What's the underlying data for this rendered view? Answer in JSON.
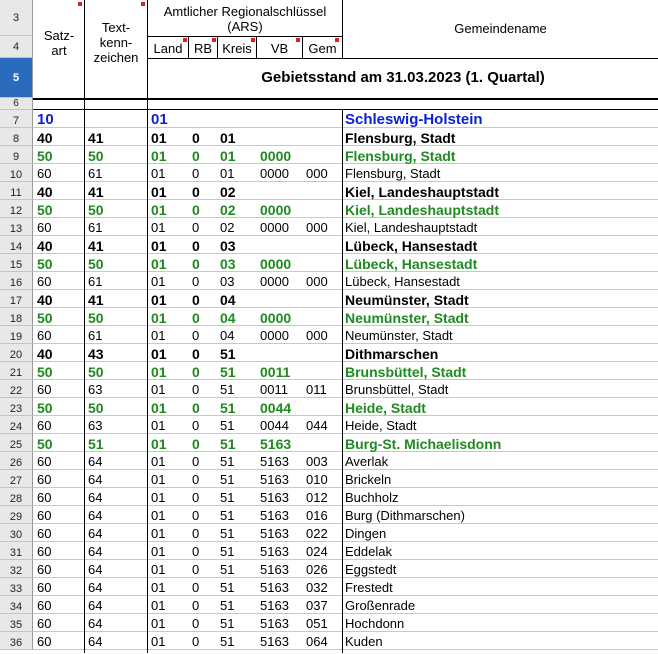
{
  "header": {
    "satzart": [
      "Satz-",
      "art"
    ],
    "textkennzeichen": [
      "Text-",
      "kenn-",
      "zeichen"
    ],
    "ars_title": [
      "Amtlicher Regionalschlüssel",
      "(ARS)"
    ],
    "land": "Land",
    "rb": "RB",
    "kreis": "Kreis",
    "vb": "VB",
    "gem": "Gem",
    "gemeindename": "Gemeindename",
    "gebietsstand": "Gebietsstand am 31.03.2023 (1. Quartal)"
  },
  "header_rows": [
    "3",
    "4",
    "5",
    "6"
  ],
  "rows": [
    {
      "n": "7",
      "style": "blue",
      "satz": "10",
      "text": "",
      "land": "01",
      "rb": "",
      "kreis": "",
      "vb": "",
      "gem": "",
      "name": "Schleswig-Holstein"
    },
    {
      "n": "8",
      "style": "bold",
      "satz": "40",
      "text": "41",
      "land": "01",
      "rb": "0",
      "kreis": "01",
      "vb": "",
      "gem": "",
      "name": "Flensburg, Stadt"
    },
    {
      "n": "9",
      "style": "green",
      "satz": "50",
      "text": "50",
      "land": "01",
      "rb": "0",
      "kreis": "01",
      "vb": "0000",
      "gem": "",
      "name": "Flensburg, Stadt"
    },
    {
      "n": "10",
      "style": "plain",
      "satz": "60",
      "text": "61",
      "land": "01",
      "rb": "0",
      "kreis": "01",
      "vb": "0000",
      "gem": "000",
      "name": "Flensburg, Stadt"
    },
    {
      "n": "11",
      "style": "bold",
      "satz": "40",
      "text": "41",
      "land": "01",
      "rb": "0",
      "kreis": "02",
      "vb": "",
      "gem": "",
      "name": "Kiel, Landeshauptstadt"
    },
    {
      "n": "12",
      "style": "green",
      "satz": "50",
      "text": "50",
      "land": "01",
      "rb": "0",
      "kreis": "02",
      "vb": "0000",
      "gem": "",
      "name": "Kiel, Landeshauptstadt"
    },
    {
      "n": "13",
      "style": "plain",
      "satz": "60",
      "text": "61",
      "land": "01",
      "rb": "0",
      "kreis": "02",
      "vb": "0000",
      "gem": "000",
      "name": "Kiel, Landeshauptstadt"
    },
    {
      "n": "14",
      "style": "bold",
      "satz": "40",
      "text": "41",
      "land": "01",
      "rb": "0",
      "kreis": "03",
      "vb": "",
      "gem": "",
      "name": "Lübeck, Hansestadt"
    },
    {
      "n": "15",
      "style": "green",
      "satz": "50",
      "text": "50",
      "land": "01",
      "rb": "0",
      "kreis": "03",
      "vb": "0000",
      "gem": "",
      "name": "Lübeck, Hansestadt"
    },
    {
      "n": "16",
      "style": "plain",
      "satz": "60",
      "text": "61",
      "land": "01",
      "rb": "0",
      "kreis": "03",
      "vb": "0000",
      "gem": "000",
      "name": "Lübeck, Hansestadt"
    },
    {
      "n": "17",
      "style": "bold",
      "satz": "40",
      "text": "41",
      "land": "01",
      "rb": "0",
      "kreis": "04",
      "vb": "",
      "gem": "",
      "name": "Neumünster, Stadt"
    },
    {
      "n": "18",
      "style": "green",
      "satz": "50",
      "text": "50",
      "land": "01",
      "rb": "0",
      "kreis": "04",
      "vb": "0000",
      "gem": "",
      "name": "Neumünster, Stadt"
    },
    {
      "n": "19",
      "style": "plain",
      "satz": "60",
      "text": "61",
      "land": "01",
      "rb": "0",
      "kreis": "04",
      "vb": "0000",
      "gem": "000",
      "name": "Neumünster, Stadt"
    },
    {
      "n": "20",
      "style": "bold",
      "satz": "40",
      "text": "43",
      "land": "01",
      "rb": "0",
      "kreis": "51",
      "vb": "",
      "gem": "",
      "name": "Dithmarschen"
    },
    {
      "n": "21",
      "style": "green",
      "satz": "50",
      "text": "50",
      "land": "01",
      "rb": "0",
      "kreis": "51",
      "vb": "0011",
      "gem": "",
      "name": "Brunsbüttel, Stadt"
    },
    {
      "n": "22",
      "style": "plain",
      "satz": "60",
      "text": "63",
      "land": "01",
      "rb": "0",
      "kreis": "51",
      "vb": "0011",
      "gem": "011",
      "name": "Brunsbüttel, Stadt"
    },
    {
      "n": "23",
      "style": "green",
      "satz": "50",
      "text": "50",
      "land": "01",
      "rb": "0",
      "kreis": "51",
      "vb": "0044",
      "gem": "",
      "name": "Heide, Stadt"
    },
    {
      "n": "24",
      "style": "plain",
      "satz": "60",
      "text": "63",
      "land": "01",
      "rb": "0",
      "kreis": "51",
      "vb": "0044",
      "gem": "044",
      "name": "Heide, Stadt"
    },
    {
      "n": "25",
      "style": "green",
      "satz": "50",
      "text": "51",
      "land": "01",
      "rb": "0",
      "kreis": "51",
      "vb": "5163",
      "gem": "",
      "name": "Burg-St. Michaelisdonn"
    },
    {
      "n": "26",
      "style": "plain",
      "satz": "60",
      "text": "64",
      "land": "01",
      "rb": "0",
      "kreis": "51",
      "vb": "5163",
      "gem": "003",
      "name": "Averlak"
    },
    {
      "n": "27",
      "style": "plain",
      "satz": "60",
      "text": "64",
      "land": "01",
      "rb": "0",
      "kreis": "51",
      "vb": "5163",
      "gem": "010",
      "name": "Brickeln"
    },
    {
      "n": "28",
      "style": "plain",
      "satz": "60",
      "text": "64",
      "land": "01",
      "rb": "0",
      "kreis": "51",
      "vb": "5163",
      "gem": "012",
      "name": "Buchholz"
    },
    {
      "n": "29",
      "style": "plain",
      "satz": "60",
      "text": "64",
      "land": "01",
      "rb": "0",
      "kreis": "51",
      "vb": "5163",
      "gem": "016",
      "name": "Burg (Dithmarschen)"
    },
    {
      "n": "30",
      "style": "plain",
      "satz": "60",
      "text": "64",
      "land": "01",
      "rb": "0",
      "kreis": "51",
      "vb": "5163",
      "gem": "022",
      "name": "Dingen"
    },
    {
      "n": "31",
      "style": "plain",
      "satz": "60",
      "text": "64",
      "land": "01",
      "rb": "0",
      "kreis": "51",
      "vb": "5163",
      "gem": "024",
      "name": "Eddelak"
    },
    {
      "n": "32",
      "style": "plain",
      "satz": "60",
      "text": "64",
      "land": "01",
      "rb": "0",
      "kreis": "51",
      "vb": "5163",
      "gem": "026",
      "name": "Eggstedt"
    },
    {
      "n": "33",
      "style": "plain",
      "satz": "60",
      "text": "64",
      "land": "01",
      "rb": "0",
      "kreis": "51",
      "vb": "5163",
      "gem": "032",
      "name": "Frestedt"
    },
    {
      "n": "34",
      "style": "plain",
      "satz": "60",
      "text": "64",
      "land": "01",
      "rb": "0",
      "kreis": "51",
      "vb": "5163",
      "gem": "037",
      "name": "Großenrade"
    },
    {
      "n": "35",
      "style": "plain",
      "satz": "60",
      "text": "64",
      "land": "01",
      "rb": "0",
      "kreis": "51",
      "vb": "5163",
      "gem": "051",
      "name": "Hochdonn"
    },
    {
      "n": "36",
      "style": "plain",
      "satz": "60",
      "text": "64",
      "land": "01",
      "rb": "0",
      "kreis": "51",
      "vb": "5163",
      "gem": "064",
      "name": "Kuden"
    }
  ],
  "colors": {
    "blue": "#0b1fd4",
    "green": "#1f8a1f",
    "comment_marker": "#e02020",
    "selected_row_header": "#2a6bbd"
  }
}
